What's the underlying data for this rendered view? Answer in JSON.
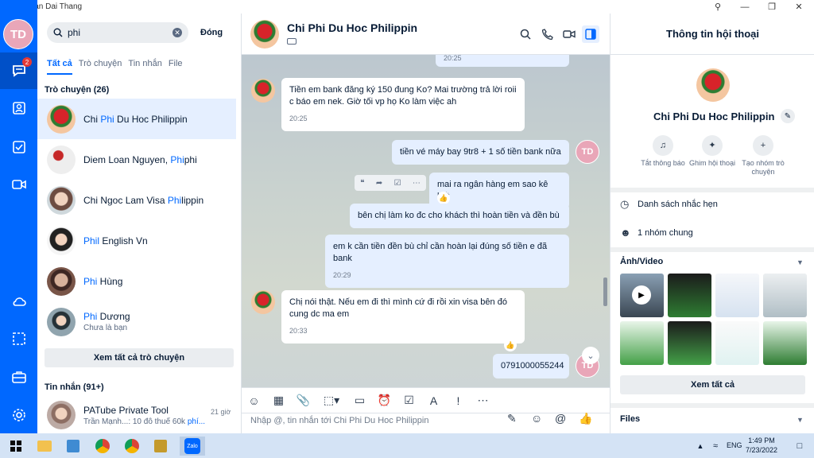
{
  "window": {
    "title": "Zalo - Tran Dai Thang"
  },
  "user": {
    "initials": "TD",
    "unread_badge": "2"
  },
  "search": {
    "value": "phi",
    "placeholder": "",
    "close_label": "Đóng"
  },
  "tabs": [
    {
      "label": "Tất cả"
    },
    {
      "label": "Trò chuyện"
    },
    {
      "label": "Tin nhắn"
    },
    {
      "label": "File"
    }
  ],
  "conversations_section": {
    "label": "Trò chuyện (26)"
  },
  "conversations": [
    {
      "pre": "Chi ",
      "hl": "Phi",
      "post": " Du Hoc Philippin",
      "sub": ""
    },
    {
      "pre": "Diem Loan Nguyen, ",
      "hl": "Phi",
      "post": "phi",
      "sub": ""
    },
    {
      "pre": "Chi Ngoc Lam Visa ",
      "hl": "Phi",
      "post": "lippin",
      "sub": ""
    },
    {
      "pre": "",
      "hl": "Phil",
      "post": " English Vn",
      "sub": ""
    },
    {
      "pre": "",
      "hl": "Phi",
      "post": " Hùng",
      "sub": ""
    },
    {
      "pre": "",
      "hl": "Phi",
      "post": " Dương",
      "sub": "Chưa là bạn"
    }
  ],
  "see_all_conversations": "Xem tất cả trò chuyện",
  "messages_section": {
    "label": "Tin nhắn (91+)"
  },
  "message_result": {
    "name": "PATube Private Tool",
    "time": "21 giờ",
    "preview_sender": "Trần Mạnh...: 10 đô thuế 60k ",
    "preview_hl": "phí..."
  },
  "chat": {
    "title": "Chi Phi Du Hoc Philippin",
    "messages": [
      {
        "text": "",
        "time": "20:25"
      },
      {
        "text": "Tiền em bank đăng ký 150 đung Ko? Mai trường trả lời roii c báo em nek. Giờ tối vp họ Ko làm việc ah",
        "time": "20:25"
      },
      {
        "text": "tiền vé máy bay 9tr8 + 1 số tiền bank nữa",
        "time": ""
      },
      {
        "text": "mai ra ngân hàng em sao kê hết",
        "time": ""
      },
      {
        "text": "bên chị làm ko đc cho khách thì hoàn tiền và đền bù",
        "time": ""
      },
      {
        "text": "em k cần tiền đền bù chỉ cần hoàn lại đúng số tiền e đã bank",
        "time": "20:29"
      },
      {
        "text": "Chị nói thật. Nếu em đi thì mình cứ đi rồi xin visa bên đó cung dc ma em",
        "time": "20:33"
      },
      {
        "text": "0791000055244",
        "time": ""
      }
    ],
    "input_placeholder": "Nhập @, tin nhắn tới Chi Phi Du Hoc Philippin"
  },
  "info": {
    "header": "Thông tin hội thoại",
    "name": "Chi Phi Du Hoc Philippin",
    "actions": [
      {
        "label": "Tắt thông báo"
      },
      {
        "label": "Ghim hội thoại"
      },
      {
        "label": "Tạo nhóm trò chuyện"
      }
    ],
    "reminders": "Danh sách nhắc hẹn",
    "groups": "1 nhóm chung",
    "media_title": "Ảnh/Video",
    "see_all": "Xem tất cả",
    "files_title": "Files"
  },
  "taskbar": {
    "lang": "ENG",
    "time": "1:49 PM",
    "date": "7/23/2022"
  },
  "colors": {
    "accent": "#0068ff",
    "rail": "#0068ff",
    "bubble_out": "#e5efff",
    "avatar_td": "#e9a6b8"
  },
  "icons": [
    "search-icon",
    "phone-icon",
    "video-icon",
    "sidebar-toggle-icon",
    "chat-icon",
    "contacts-icon",
    "todo-icon",
    "cloud-icon",
    "screenshot-icon",
    "briefcase-icon",
    "gear-icon"
  ]
}
